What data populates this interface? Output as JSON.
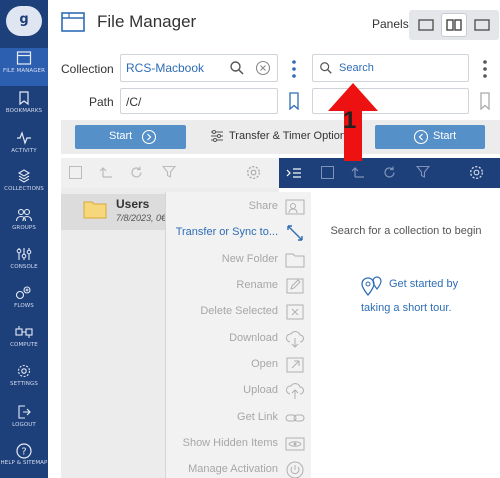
{
  "app": {
    "title": "File Manager",
    "logo_letter": "g"
  },
  "nav": {
    "items": [
      {
        "label": "FILE MANAGER",
        "icon": "file-manager-icon"
      },
      {
        "label": "BOOKMARKS",
        "icon": "bookmark-icon"
      },
      {
        "label": "ACTIVITY",
        "icon": "activity-icon"
      },
      {
        "label": "COLLECTIONS",
        "icon": "collections-icon"
      },
      {
        "label": "GROUPS",
        "icon": "groups-icon"
      },
      {
        "label": "CONSOLE",
        "icon": "console-icon"
      },
      {
        "label": "FLOWS",
        "icon": "flows-icon"
      },
      {
        "label": "COMPUTE",
        "icon": "compute-icon"
      },
      {
        "label": "SETTINGS",
        "icon": "settings-icon"
      },
      {
        "label": "LOGOUT",
        "icon": "logout-icon"
      },
      {
        "label": "HELP & SITEMAP",
        "icon": "help-icon"
      }
    ]
  },
  "header": {
    "panels_label": "Panels"
  },
  "left_panel": {
    "collection_label": "Collection",
    "collection_value": "RCS-Macbook",
    "path_label": "Path",
    "path_value": "/C/"
  },
  "right_panel": {
    "search_placeholder": "Search",
    "empty_message": "Search for a collection to begin",
    "tour_line1": "Get started by",
    "tour_line2": "taking a short tour."
  },
  "start_bar": {
    "start_left": "Start",
    "transfer_options": "Transfer & Timer Options",
    "start_right": "Start"
  },
  "file_list": [
    {
      "name": "Users",
      "date": "7/8/2023, 0€"
    }
  ],
  "context_menu": [
    {
      "label": "Share",
      "icon": "share-icon",
      "highlighted": false
    },
    {
      "label": "Transfer or Sync to...",
      "icon": "transfer-icon",
      "highlighted": true
    },
    {
      "label": "New Folder",
      "icon": "new-folder-icon",
      "highlighted": false
    },
    {
      "label": "Rename",
      "icon": "rename-icon",
      "highlighted": false
    },
    {
      "label": "Delete Selected",
      "icon": "delete-icon",
      "highlighted": false
    },
    {
      "label": "Download",
      "icon": "download-icon",
      "highlighted": false
    },
    {
      "label": "Open",
      "icon": "open-icon",
      "highlighted": false
    },
    {
      "label": "Upload",
      "icon": "upload-icon",
      "highlighted": false
    },
    {
      "label": "Get Link",
      "icon": "link-icon",
      "highlighted": false
    },
    {
      "label": "Show Hidden Items",
      "icon": "eye-icon",
      "highlighted": false
    },
    {
      "label": "Manage Activation",
      "icon": "power-icon",
      "highlighted": false
    }
  ],
  "annotation": {
    "step": "1"
  },
  "colors": {
    "nav_bg": "#1d3f7a",
    "nav_active": "#2d5fb1",
    "accent_blue": "#2e6db4",
    "start_btn": "#5590c8",
    "arrow_red": "#ee1111"
  }
}
